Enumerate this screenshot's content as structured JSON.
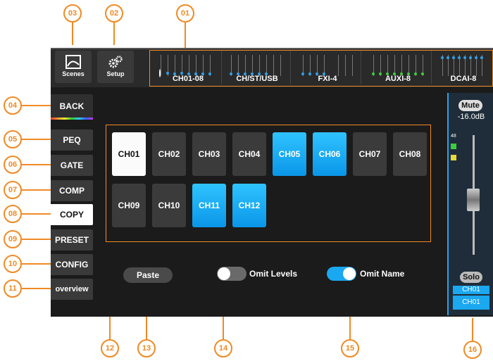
{
  "callouts": [
    "01",
    "02",
    "03",
    "04",
    "05",
    "06",
    "07",
    "08",
    "09",
    "10",
    "11",
    "12",
    "13",
    "14",
    "15",
    "16"
  ],
  "topbar": {
    "scenes_label": "Scenes",
    "setup_label": "Setup",
    "fader_groups": [
      "CH01-08",
      "CH/ST/USB",
      "FXI-4",
      "AUXI-8",
      "DCAI-8"
    ]
  },
  "sidebar": {
    "items": [
      {
        "label": "BACK"
      },
      {
        "label": "PEQ"
      },
      {
        "label": "GATE"
      },
      {
        "label": "COMP"
      },
      {
        "label": "COPY"
      },
      {
        "label": "PRESET"
      },
      {
        "label": "CONFIG"
      },
      {
        "label": "overview"
      }
    ]
  },
  "channels": [
    {
      "label": "CH01",
      "state": "white"
    },
    {
      "label": "CH02",
      "state": "gray"
    },
    {
      "label": "CH03",
      "state": "gray"
    },
    {
      "label": "CH04",
      "state": "gray"
    },
    {
      "label": "CH05",
      "state": "blue"
    },
    {
      "label": "CH06",
      "state": "blue"
    },
    {
      "label": "CH07",
      "state": "gray"
    },
    {
      "label": "CH08",
      "state": "gray"
    },
    {
      "label": "CH09",
      "state": "gray"
    },
    {
      "label": "CH10",
      "state": "gray"
    },
    {
      "label": "CH11",
      "state": "blue"
    },
    {
      "label": "CH12",
      "state": "blue"
    }
  ],
  "actions": {
    "paste_label": "Paste",
    "omit_levels_label": "Omit Levels",
    "omit_levels_on": false,
    "omit_name_label": "Omit Name",
    "omit_name_on": true
  },
  "right_panel": {
    "mute_label": "Mute",
    "level": "-16.0dB",
    "meter_top": "48",
    "solo_label": "Solo",
    "ch_tag_top": "CH01",
    "ch_tag_bottom": "CH01"
  },
  "colors": {
    "accent": "#f08a24",
    "selected_blue": "#1aa8f0",
    "bg": "#1b1b1b"
  }
}
